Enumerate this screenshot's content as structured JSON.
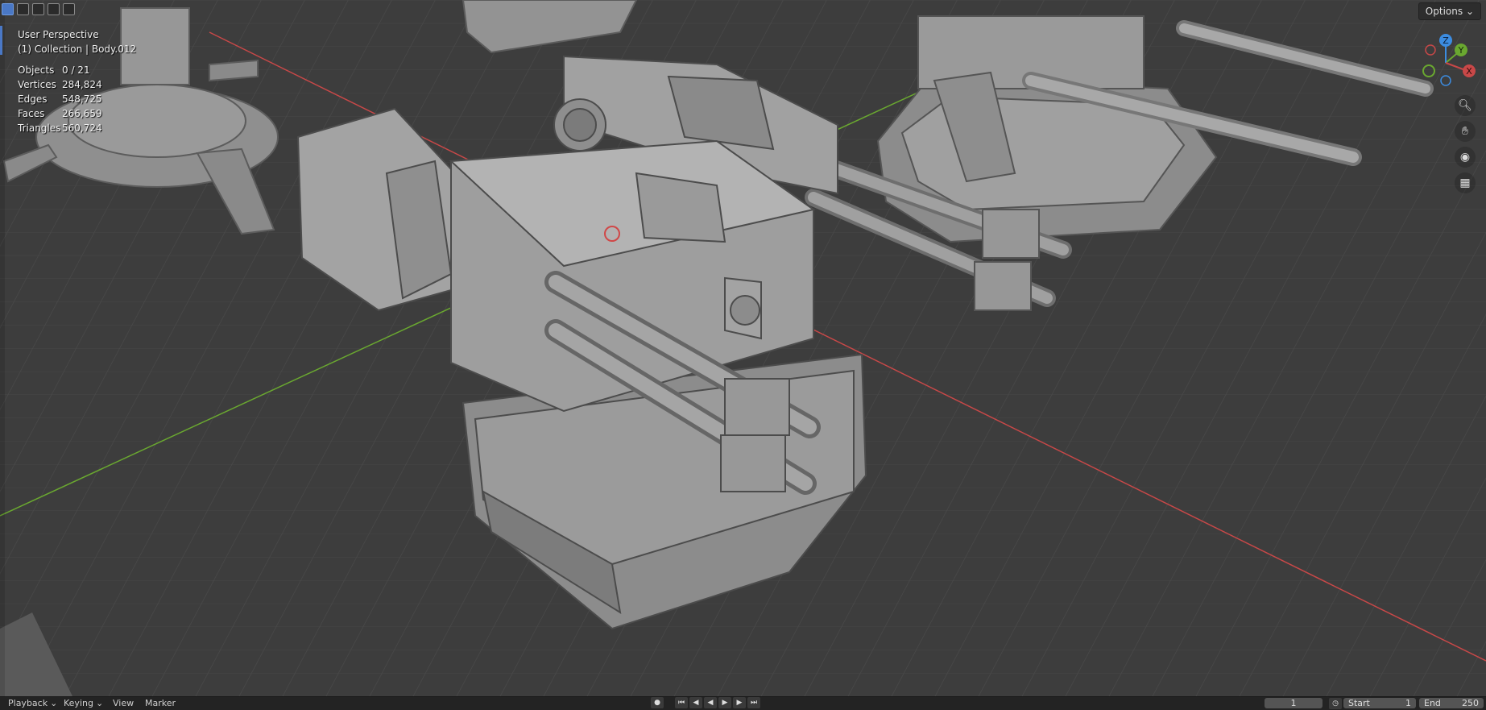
{
  "viewport": {
    "perspective": "User Perspective",
    "collection": "(1) Collection | Body.012",
    "stats": [
      {
        "label": "Objects",
        "value": "0 / 21"
      },
      {
        "label": "Vertices",
        "value": "284,824"
      },
      {
        "label": "Edges",
        "value": "548,725"
      },
      {
        "label": "Faces",
        "value": "266,659"
      },
      {
        "label": "Triangles",
        "value": "560,724"
      }
    ],
    "options_label": "Options",
    "gizmo": {
      "x": "X",
      "y": "Y",
      "z": "Z"
    },
    "icons": [
      "zoom-icon",
      "hand-pan-icon",
      "camera-icon",
      "grid-ortho-icon"
    ]
  },
  "timeline": {
    "menus": [
      "Playback",
      "Keying",
      "View",
      "Marker"
    ],
    "current_frame": "1",
    "start_label": "Start",
    "start_value": "1",
    "end_label": "End",
    "end_value": "250"
  },
  "colors": {
    "x_axis": "#c84848",
    "y_axis": "#6aa830",
    "z_axis": "#3c8ce0",
    "accent": "#4a78c6"
  }
}
